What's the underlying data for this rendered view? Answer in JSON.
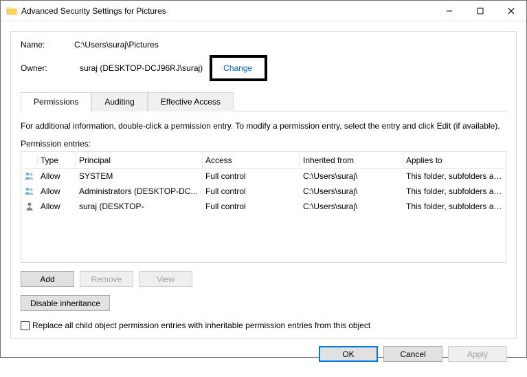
{
  "window": {
    "title": "Advanced Security Settings for Pictures"
  },
  "fields": {
    "name_label": "Name:",
    "name_value": "C:\\Users\\suraj\\Pictures",
    "owner_label": "Owner:",
    "owner_value": "suraj (DESKTOP-DCJ96RJ\\suraj)",
    "change_link": "Change"
  },
  "tabs": {
    "permissions": "Permissions",
    "auditing": "Auditing",
    "effective_access": "Effective Access"
  },
  "info_text": "For additional information, double-click a permission entry. To modify a permission entry, select the entry and click Edit (if available).",
  "subhead": "Permission entries:",
  "columns": {
    "type": "Type",
    "principal": "Principal",
    "access": "Access",
    "inherited": "Inherited from",
    "applies": "Applies to"
  },
  "rows": [
    {
      "icon": "group",
      "type": "Allow",
      "principal": "SYSTEM",
      "access": "Full control",
      "inherited": "C:\\Users\\suraj\\",
      "applies": "This folder, subfolders and files"
    },
    {
      "icon": "group",
      "type": "Allow",
      "principal": "Administrators (DESKTOP-DC...",
      "access": "Full control",
      "inherited": "C:\\Users\\suraj\\",
      "applies": "This folder, subfolders and files"
    },
    {
      "icon": "user",
      "type": "Allow",
      "principal": "suraj (DESKTOP-",
      "access": "Full control",
      "inherited": "C:\\Users\\suraj\\",
      "applies": "This folder, subfolders and files"
    }
  ],
  "buttons": {
    "add": "Add",
    "remove": "Remove",
    "view": "View",
    "disable_inheritance": "Disable inheritance",
    "ok": "OK",
    "cancel": "Cancel",
    "apply": "Apply"
  },
  "checkbox_label": "Replace all child object permission entries with inheritable permission entries from this object"
}
